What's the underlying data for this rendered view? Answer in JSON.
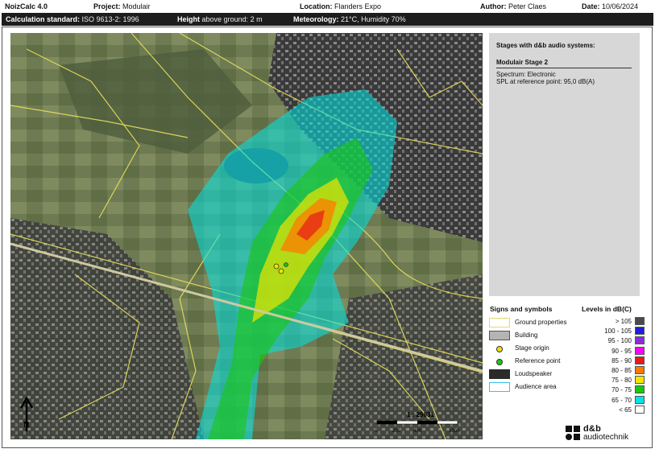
{
  "header": {
    "app": "NoizCalc 4.0",
    "project_label": "Project:",
    "project_value": "Modulair",
    "location_label": "Location:",
    "location_value": "Flanders Expo",
    "author_label": "Author:",
    "author_value": "Peter Claes",
    "date_label": "Date:",
    "date_value": "10/06/2024"
  },
  "infobar": {
    "calc_label": "Calculation standard:",
    "calc_value": "ISO 9613-2: 1996",
    "height_label": "Height",
    "height_value": "above ground: 2 m",
    "meteo_label": "Meteorology:",
    "meteo_value": "21°C, Humidity 70%"
  },
  "stages": {
    "title": "Stages with d&b audio systems:",
    "stage_name": "Modulair Stage 2",
    "spectrum": "Spectrum:   Electronic",
    "spl": "SPL at reference point:  95,0 dB(A)"
  },
  "signs": {
    "title": "Signs and symbols",
    "items": [
      {
        "label": "Ground properties",
        "symbol": "ground"
      },
      {
        "label": "Building",
        "symbol": "building"
      },
      {
        "label": "Stage origin",
        "symbol": "stage-origin"
      },
      {
        "label": "Reference point",
        "symbol": "reference-point"
      },
      {
        "label": "Loudspeaker",
        "symbol": "loudspeaker"
      },
      {
        "label": "Audience area",
        "symbol": "audience"
      }
    ]
  },
  "levels": {
    "title": "Levels in dB(C)",
    "items": [
      {
        "label": "> 105",
        "color": "#4a4a4a"
      },
      {
        "label": "100 -  105",
        "color": "#1f1fd6"
      },
      {
        "label": "95 -  100",
        "color": "#8a2be2"
      },
      {
        "label": "90 -   95",
        "color": "#ff00ff"
      },
      {
        "label": "85 -   90",
        "color": "#e81919"
      },
      {
        "label": "80 -   85",
        "color": "#ff7a00"
      },
      {
        "label": "75 -   80",
        "color": "#f0e600"
      },
      {
        "label": "70 -   75",
        "color": "#19c80f"
      },
      {
        "label": "65 -   70",
        "color": "#00e5e5"
      },
      {
        "label": "<   65",
        "color": "#ffffff"
      }
    ]
  },
  "map": {
    "scale_text": "1 : 29631",
    "scale_ticks": [
      "0",
      "200",
      "400",
      "1000"
    ],
    "north_label": "N"
  },
  "logo": {
    "line1": "d&b",
    "line2": "audiotechnik"
  }
}
